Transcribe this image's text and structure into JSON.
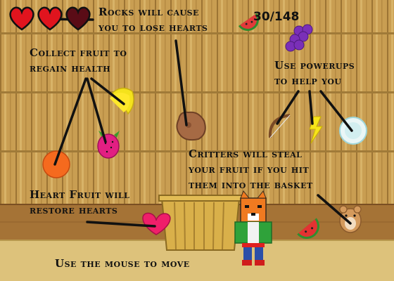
{
  "hud": {
    "hearts": [
      {
        "state": "full",
        "icon": "heart-icon",
        "color": "#e0141e"
      },
      {
        "state": "full",
        "icon": "heart-icon",
        "color": "#e0141e"
      },
      {
        "state": "empty",
        "icon": "heart-icon",
        "color": "#5a0c16"
      }
    ],
    "score": "30/148"
  },
  "tips": {
    "rocks": "Rocks will cause\nyou to lose hearts",
    "fruit": "Collect fruit to\nregain health",
    "powerups": "Use powerups\nto help you",
    "critters": "Critters will steal\nyour fruit if you hit\nthem into the basket",
    "heart_fruit": "Heart Fruit will\nrestore hearts",
    "mouse": "Use the mouse to move"
  },
  "items": {
    "fruits": [
      "watermelon-slice-icon",
      "grapes-icon",
      "banana-icon",
      "dragonfruit-icon",
      "orange-icon",
      "watermelon-slice-icon"
    ],
    "rock": "rock-icon",
    "powerups": [
      "bow-icon",
      "lightning-bolt-icon",
      "shield-bubble-icon"
    ],
    "heart_fruit": "heart-fruit-icon",
    "critter": "hamster-icon",
    "player": "fox-character",
    "basket": "basket"
  },
  "colors": {
    "wood_wall": "#c9a055",
    "wood_floor": "#a27034",
    "ground": "#dcc07a",
    "heart": "#e0141e"
  }
}
